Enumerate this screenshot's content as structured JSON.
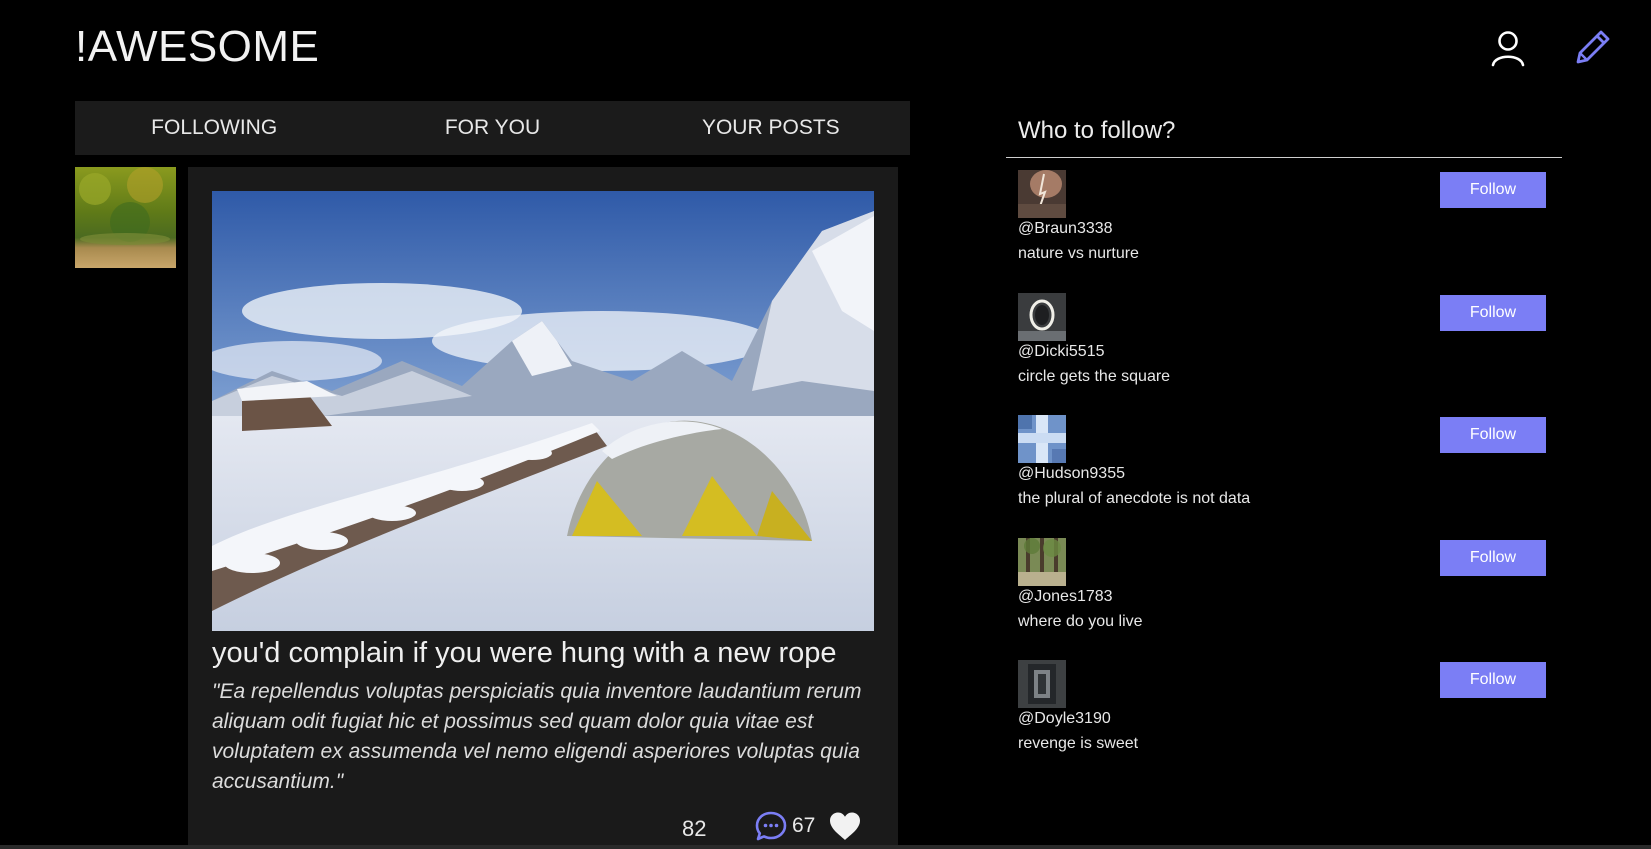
{
  "app": {
    "logo": "!AWESOME"
  },
  "header": {
    "profile_icon": "user-icon",
    "compose_icon": "pencil-icon",
    "accent": "#7b7ef5"
  },
  "tabs": [
    {
      "label": "FOLLOWING"
    },
    {
      "label": "FOR YOU"
    },
    {
      "label": "YOUR POSTS"
    }
  ],
  "post": {
    "title": "you'd complain if you were hung with a new rope",
    "body": "\"Ea repellendus voluptas perspiciatis quia inventore laudantium rerum aliquam odit fugiat hic et possimus sed quam dolor quia vitae est voluptatem ex assumenda vel nemo eligendi asperiores voluptas quia accusantium.\"",
    "comment_count": "82",
    "like_count": "67"
  },
  "sidebar": {
    "title": "Who to follow?",
    "follow_label": "Follow",
    "suggestions": [
      {
        "handle": "@Braun3338",
        "bio": "nature vs nurture",
        "follow_label": "Follow"
      },
      {
        "handle": "@Dicki5515",
        "bio": "circle gets the square",
        "follow_label": "Follow"
      },
      {
        "handle": "@Hudson9355",
        "bio": "the plural of anecdote is not data",
        "follow_label": "Follow"
      },
      {
        "handle": "@Jones1783",
        "bio": "where do you live",
        "follow_label": "Follow"
      },
      {
        "handle": "@Doyle3190",
        "bio": "revenge is sweet",
        "follow_label": "Follow"
      }
    ]
  }
}
